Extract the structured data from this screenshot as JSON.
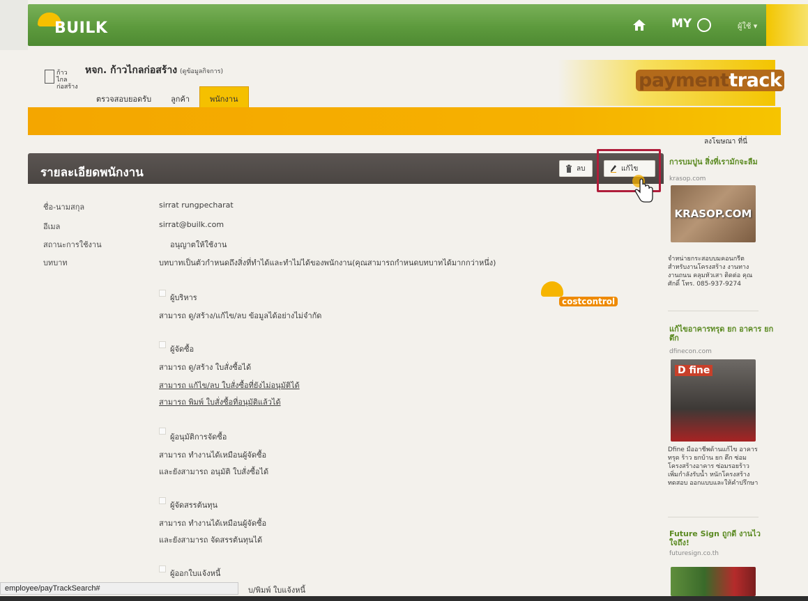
{
  "nav": {
    "brand": "BUILK",
    "my_label": "MY",
    "user_menu": "ผู้ใช้ ▾"
  },
  "header": {
    "company_logo_text": "ก้าวไกล ก่อสร้าง",
    "company_name": "หจก. ก้าวไกลก่อสร้าง",
    "company_sub": "(ดูข้อมูลกิจการ)",
    "tabs": [
      {
        "label": "ตรวจสอบยอดรับ",
        "active": false
      },
      {
        "label": "ลูกค้า",
        "active": false
      },
      {
        "label": "พนักงาน",
        "active": true
      }
    ],
    "product_logo_part1": "payment",
    "product_logo_part2": "track"
  },
  "panel": {
    "title": "รายละเอียดพนักงาน",
    "delete_label": "ลบ",
    "edit_label": "แก้ไข"
  },
  "employee": {
    "name_label": "ชื่อ-นามสกุล",
    "name_value": "sirrat rungpecharat",
    "email_label": "อีเมล",
    "email_value": "sirrat@builk.com",
    "status_label": "สถานะการใช้งาน",
    "status_value": "อนุญาตให้ใช้งาน",
    "role_label": "บทบาท",
    "role_desc": "บทบาทเป็นตัวกำหนดถึงสิ่งที่ทำได้และทำไม่ได้ของพนักงาน(คุณสามารถกำหนดบทบาทได้มากกว่าหนึ่ง)"
  },
  "roles": [
    {
      "name": "ผู้บริหาร",
      "lines": [
        "สามารถ ดู/สร้าง/แก้ไข/ลบ ข้อมูลได้อย่างไม่จำกัด"
      ]
    },
    {
      "name": "ผู้จัดซื้อ",
      "lines": [
        "สามารถ ดู/สร้าง ใบสั่งซื้อได้",
        "สามารถ แก้ไข/ลบ ใบสั่งซื้อที่ยังไม่อนุมัติได้",
        "สามารถ พิมพ์ ใบสั่งซื้อที่อนุมัติแล้วได้"
      ]
    },
    {
      "name": "ผู้อนุมัติการจัดซื้อ",
      "lines": [
        "สามารถ ทำงานได้เหมือนผู้จัดซื้อ",
        "และยังสามารถ อนุมัติ ใบสั่งซื้อได้"
      ]
    },
    {
      "name": "ผู้จัดสรรต้นทุน",
      "lines": [
        "สามารถ ทำงานได้เหมือนผู้จัดซื้อ",
        "และยังสามารถ จัดสรรต้นทุนได้"
      ]
    },
    {
      "name": "ผู้ออกใบแจ้งหนี้",
      "lines": [
        "บ/พิมพ์ ใบแจ้งหนี้"
      ]
    }
  ],
  "costcontrol_logo": "costcontrol",
  "sidebar": {
    "ad_header": "ลงโฆษณา ที่นี่",
    "ads": [
      {
        "title": "การบมปูน สิ่งที่เรามักจะลืม",
        "url": "krasop.com",
        "image_text": "KRASOP.COM",
        "desc": "จำหน่ายกระสอบบมคอนกรีต สำหรับงานโครงสร้าง งานทาง งานถนน คลุมหัวเสา ติดต่อ คุณศักดิ์ โทร. 085-937-9274"
      },
      {
        "title": "แก้ไขอาคารทรุด ยก อาคาร ยกตึก",
        "url": "dfinecon.com",
        "image_text": "D fine",
        "desc": "Dfine มืออาชีพด้านแก้ไข อาคารทรุด ร้าว ยกบ้าน ยก ตึก ซ่อมโครงสร้างอาคาร ซ่อมรอยร้าว เพิ่มกำลังรับน้ำ หนักโครงสร้าง ทดสอบ ออกแบบและให้คำปรึกษา"
      },
      {
        "title": "Future Sign ถูกดี งานไว ใจถึง!",
        "url": "futuresign.co.th",
        "image_text": "",
        "desc": ""
      }
    ]
  },
  "statusbar": {
    "url": "employee/payTrackSearch#"
  }
}
